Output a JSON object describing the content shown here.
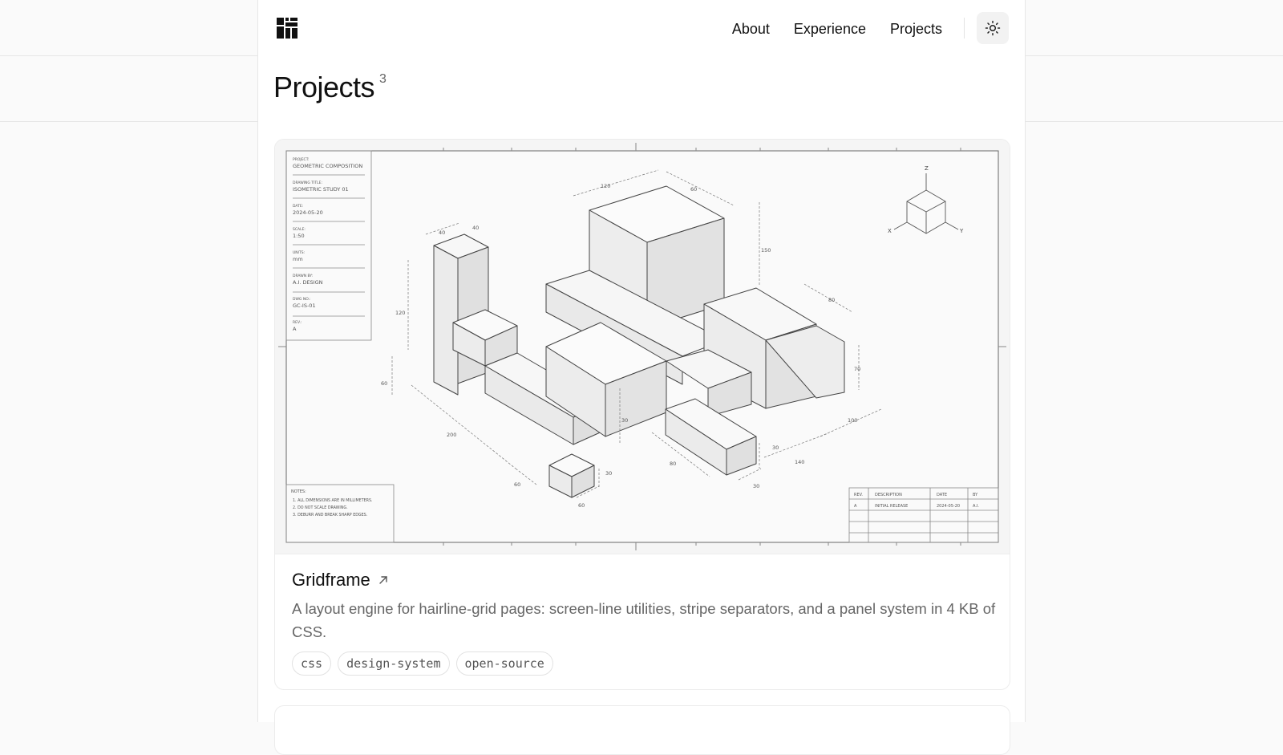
{
  "nav": {
    "about": "About",
    "experience": "Experience",
    "projects": "Projects"
  },
  "icons": {
    "logo": "grid-blocks-logo",
    "theme": "sun-icon",
    "external": "arrow-up-right-icon"
  },
  "page": {
    "title": "Projects",
    "count": "3"
  },
  "projects": [
    {
      "title": "Gridframe",
      "description": "A layout engine for hairline-grid pages: screen-line utilities, stripe separators, and a panel system in 4 KB of CSS.",
      "tags": [
        "css",
        "design-system",
        "open-source"
      ],
      "image": {
        "title_block": [
          {
            "label": "PROJECT:",
            "value": "GEOMETRIC COMPOSITION"
          },
          {
            "label": "DRAWING TITLE:",
            "value": "ISOMETRIC STUDY 01"
          },
          {
            "label": "DATE:",
            "value": "2024-05-20"
          },
          {
            "label": "SCALE:",
            "value": "1:50"
          },
          {
            "label": "UNITS:",
            "value": "mm"
          },
          {
            "label": "DRAWN BY:",
            "value": "A.I. DESIGN"
          },
          {
            "label": "DWG NO.:",
            "value": "GC-IS-01"
          },
          {
            "label": "REV.:",
            "value": "A"
          }
        ],
        "notes_title": "NOTES:",
        "notes": [
          "1. ALL DIMENSIONS ARE IN MILLIMETERS.",
          "2. DO NOT SCALE DRAWING.",
          "3. DEBURR AND BREAK SHARP EDGES."
        ],
        "rev_headers": [
          "REV.",
          "DESCRIPTION",
          "DATE",
          "BY"
        ],
        "rev_row": [
          "A",
          "INITIAL RELEASE",
          "2024-05-20",
          "A.I."
        ],
        "axes": [
          "Z",
          "X",
          "Y"
        ],
        "dims": [
          "120",
          "60",
          "40",
          "40",
          "150",
          "120",
          "60",
          "80",
          "70",
          "200",
          "60",
          "100",
          "30",
          "140",
          "80",
          "30",
          "30",
          "60",
          "30"
        ]
      }
    }
  ]
}
